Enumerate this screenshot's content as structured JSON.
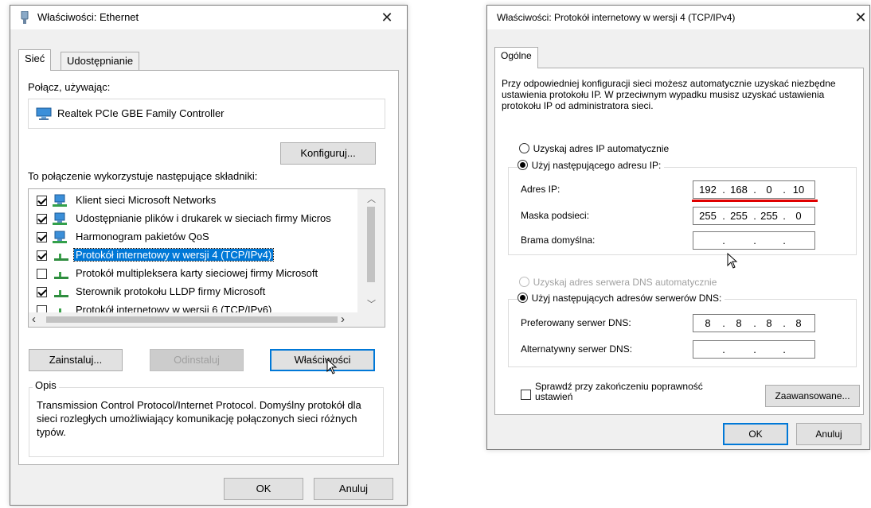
{
  "left_dialog": {
    "title": "Właściwości: Ethernet",
    "tabs": [
      "Sieć",
      "Udostępnianie"
    ],
    "connect_using_label": "Połącz, używając:",
    "adapter_name": "Realtek PCIe GBE Family Controller",
    "configure_button": "Konfiguruj...",
    "components_label": "To połączenie wykorzystuje następujące składniki:",
    "components": [
      {
        "label": "Klient sieci Microsoft Networks",
        "checked": true,
        "icon": "network-client-icon"
      },
      {
        "label": "Udostępnianie plików i drukarek w sieciach firmy Micros",
        "checked": true,
        "icon": "network-share-icon"
      },
      {
        "label": "Harmonogram pakietów QoS",
        "checked": true,
        "icon": "network-service-icon"
      },
      {
        "label": "Protokół internetowy w wersji 4 (TCP/IPv4)",
        "checked": true,
        "icon": "protocol-icon",
        "selected": true
      },
      {
        "label": "Protokół multipleksera karty sieciowej firmy Microsoft",
        "checked": false,
        "icon": "protocol-icon"
      },
      {
        "label": "Sterownik protokołu LLDP firmy Microsoft",
        "checked": true,
        "icon": "protocol-icon"
      },
      {
        "label": "Protokół internetowy w wersji 6 (TCP/IPv6)",
        "checked": false,
        "icon": "protocol-icon"
      }
    ],
    "install_button": "Zainstaluj...",
    "uninstall_button": "Odinstaluj",
    "properties_button": "Właściwości",
    "description_legend": "Opis",
    "description_text": "Transmission Control Protocol/Internet Protocol. Domyślny protokół dla sieci rozległych umożliwiający komunikację połączonych sieci różnych typów.",
    "ok_button": "OK",
    "cancel_button": "Anuluj"
  },
  "right_dialog": {
    "title": "Właściwości: Protokół internetowy w wersji 4 (TCP/IPv4)",
    "tab": "Ogólne",
    "intro_text": "Przy odpowiedniej konfiguracji sieci możesz automatycznie uzyskać niezbędne ustawienia protokołu IP. W przeciwnym wypadku musisz uzyskać ustawienia protokołu IP od administratora sieci.",
    "auto_ip_radio": "Uzyskaj adres IP automatycznie",
    "manual_ip_radio": "Użyj następującego adresu IP:",
    "ip_label": "Adres IP:",
    "ip_value": [
      "192",
      "168",
      "0",
      "10"
    ],
    "mask_label": "Maska podsieci:",
    "mask_value": [
      "255",
      "255",
      "255",
      "0"
    ],
    "gateway_label": "Brama domyślna:",
    "gateway_value": [
      "",
      "",
      "",
      ""
    ],
    "auto_dns_radio": "Uzyskaj adres serwera DNS automatycznie",
    "manual_dns_radio": "Użyj następujących adresów serwerów DNS:",
    "preferred_dns_label": "Preferowany serwer DNS:",
    "preferred_dns_value": [
      "8",
      "8",
      "8",
      "8"
    ],
    "alternate_dns_label": "Alternatywny serwer DNS:",
    "alternate_dns_value": [
      "",
      "",
      "",
      ""
    ],
    "validate_checkbox": "Sprawdź przy zakończeniu poprawność ustawień",
    "advanced_button": "Zaawansowane...",
    "ok_button": "OK",
    "cancel_button": "Anuluj"
  },
  "colors": {
    "accent": "#0078d7",
    "annotation_underline": "#e00000"
  }
}
